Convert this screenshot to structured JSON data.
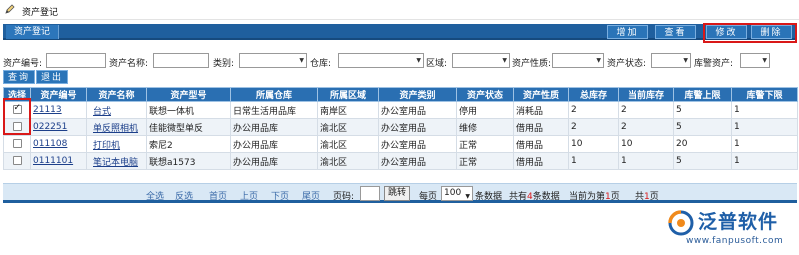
{
  "page": {
    "title": "资产登记"
  },
  "toolbar": {
    "section_label": "资产登记",
    "add_label": "增加",
    "view_label": "查看",
    "edit_label": "修改",
    "delete_label": "删除"
  },
  "filters": {
    "code_label": "资产编号:",
    "name_label": "资产名称:",
    "category_label": "类别:",
    "warehouse_label": "仓库:",
    "area_label": "区域:",
    "nature_label": "资产性质:",
    "status_label": "资产状态:",
    "alert_label": "库警资产:",
    "query_label": "查询",
    "exit_label": "退出"
  },
  "grid": {
    "headers": [
      "选择",
      "资产编号",
      "资产名称",
      "资产型号",
      "所属仓库",
      "所属区域",
      "资产类别",
      "资产状态",
      "资产性质",
      "总库存",
      "当前库存",
      "库警上限",
      "库警下限"
    ],
    "rows": [
      {
        "checked": true,
        "code": "21113",
        "name": "台式",
        "model": "联想一体机",
        "warehouse": "日常生活用品库",
        "area": "南岸区",
        "category": "办公室用品",
        "status": "停用",
        "nature": "消耗品",
        "total": "2",
        "current": "2",
        "upper": "5",
        "lower": "1"
      },
      {
        "checked": false,
        "code": "022251",
        "name": "单反照相机",
        "model": "佳能微型单反",
        "warehouse": "办公用品库",
        "area": "渝北区",
        "category": "办公室用品",
        "status": "维修",
        "nature": "借用品",
        "total": "2",
        "current": "2",
        "upper": "5",
        "lower": "1"
      },
      {
        "checked": false,
        "code": "011108",
        "name": "打印机",
        "model": "索尼2",
        "warehouse": "办公用品库",
        "area": "渝北区",
        "category": "办公室用品",
        "status": "正常",
        "nature": "借用品",
        "total": "10",
        "current": "10",
        "upper": "20",
        "lower": "1"
      },
      {
        "checked": false,
        "code": "0111101",
        "name": "笔记本电脑",
        "model": "联想a1573",
        "warehouse": "办公用品库",
        "area": "渝北区",
        "category": "办公室用品",
        "status": "正常",
        "nature": "借用品",
        "total": "1",
        "current": "1",
        "upper": "5",
        "lower": "1"
      }
    ]
  },
  "pager": {
    "select_all": "全选",
    "invert": "反选",
    "first": "首页",
    "prev": "上页",
    "next": "下页",
    "last": "尾页",
    "page_label": "页码:",
    "jump": "跳转",
    "per_page_label": "每页",
    "per_page_value": "100",
    "per_page_suffix": "条数据",
    "total_prefix": "共有",
    "total_count": "4",
    "total_suffix": "条数据",
    "current_prefix": "当前为第",
    "current_page": "1",
    "current_suffix": "页",
    "pages_prefix": "共",
    "pages_count": "1",
    "pages_suffix": "页"
  },
  "logo": {
    "brand": "泛普软件",
    "url": "www.fanpusoft.com"
  },
  "colors": {
    "toolbar": "#1f5f9e",
    "header": "#2a6fb2",
    "highlight": "#d91818",
    "pager_bg": "#d9e8f5"
  }
}
